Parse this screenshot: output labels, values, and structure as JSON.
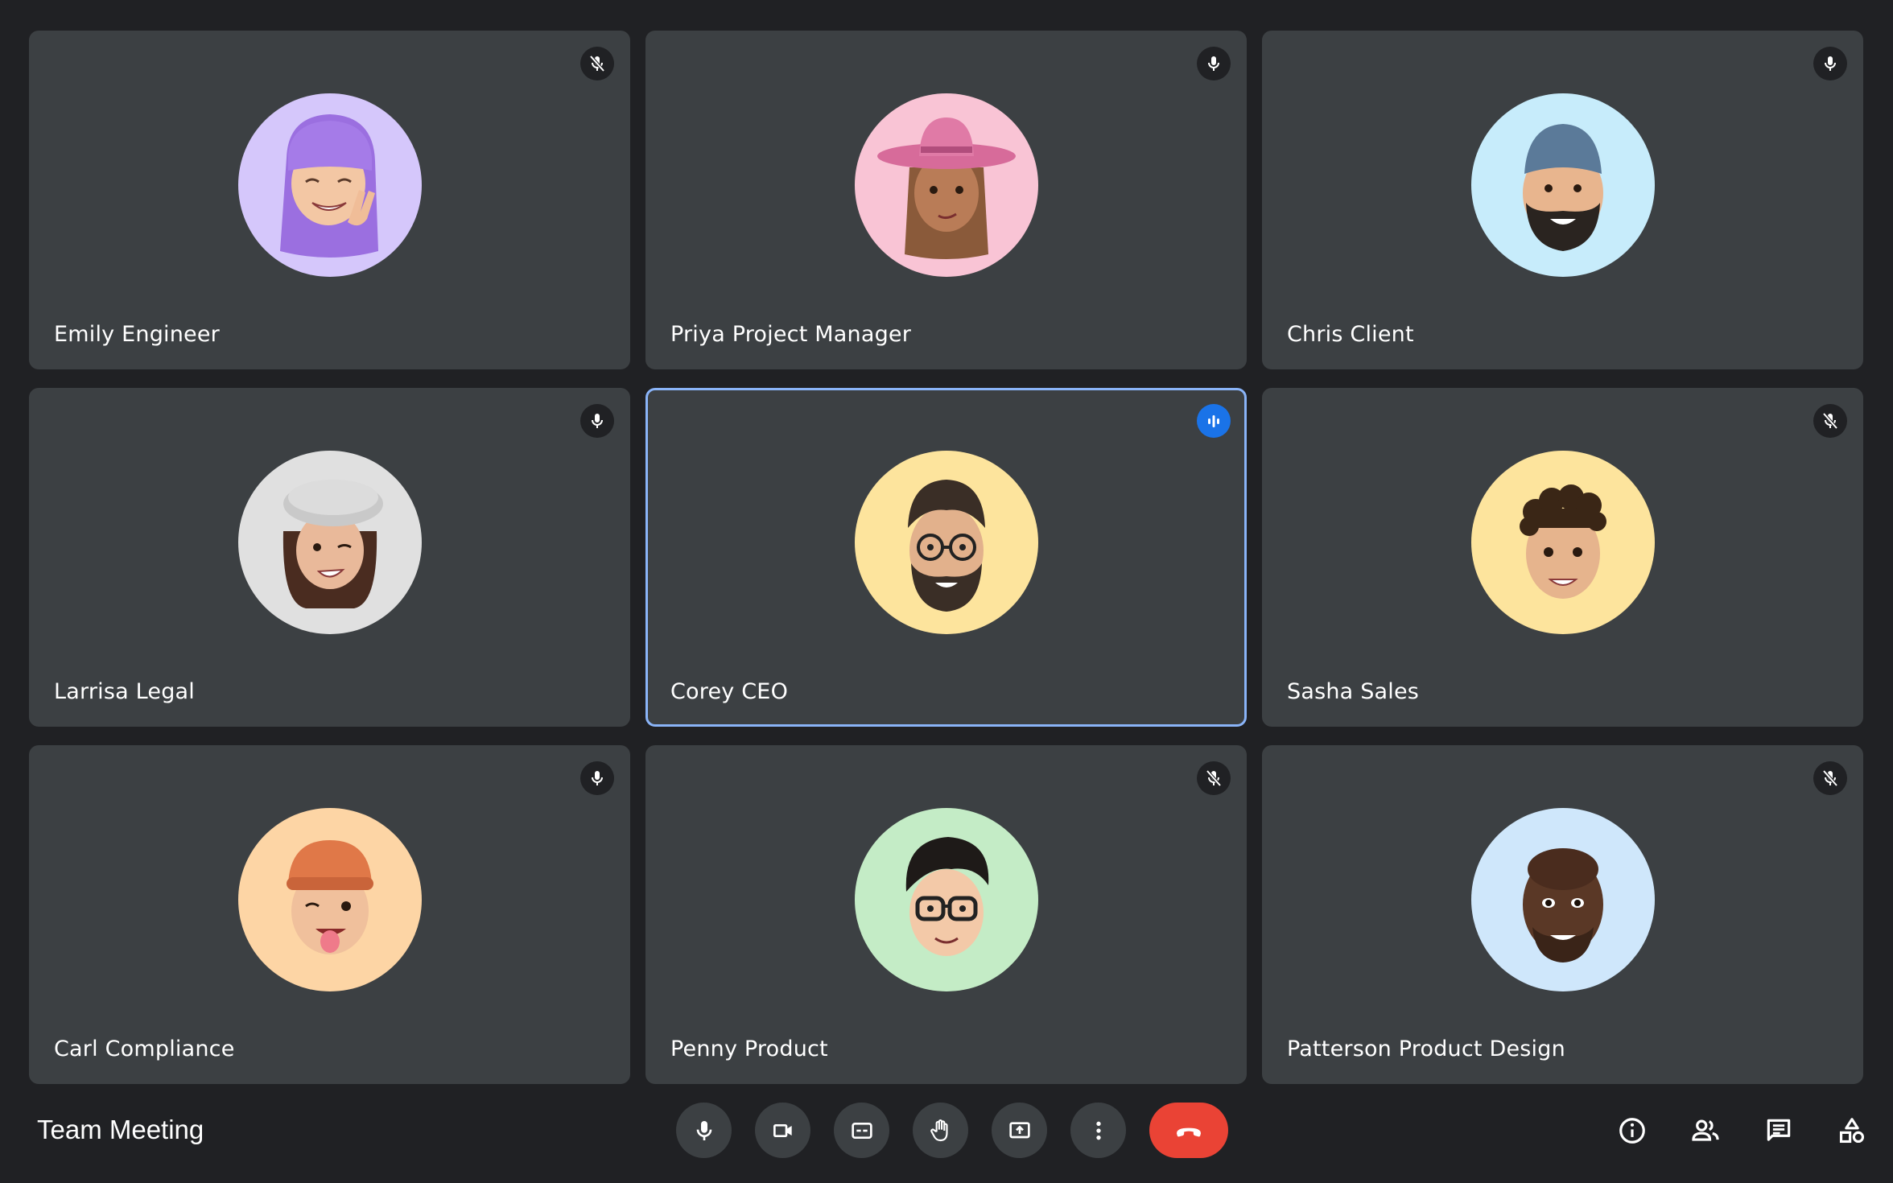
{
  "meeting": {
    "title": "Team Meeting"
  },
  "participants": [
    {
      "name": "Emily Engineer",
      "mic": "muted",
      "avatar_bg": "#d5c7fb",
      "icon": "mic-off-icon"
    },
    {
      "name": "Priya Project Manager",
      "mic": "on",
      "avatar_bg": "#f9c4d5",
      "icon": "mic-icon"
    },
    {
      "name": "Chris Client",
      "mic": "on",
      "avatar_bg": "#c7ecfb",
      "icon": "mic-icon"
    },
    {
      "name": "Larrisa Legal",
      "mic": "on",
      "avatar_bg": "#e0e0e0",
      "icon": "mic-icon"
    },
    {
      "name": "Corey CEO",
      "mic": "speaking",
      "avatar_bg": "#fde49d",
      "icon": "audio-level-icon"
    },
    {
      "name": "Sasha Sales",
      "mic": "muted",
      "avatar_bg": "#fde49d",
      "icon": "mic-off-icon"
    },
    {
      "name": "Carl Compliance",
      "mic": "on",
      "avatar_bg": "#fdd5a5",
      "icon": "mic-icon"
    },
    {
      "name": "Penny Product",
      "mic": "muted",
      "avatar_bg": "#c4ecc6",
      "icon": "mic-off-icon"
    },
    {
      "name": "Patterson Product Design",
      "mic": "muted",
      "avatar_bg": "#cfe7fb",
      "icon": "mic-off-icon"
    }
  ],
  "controls": [
    {
      "icon": "microphone-icon"
    },
    {
      "icon": "camera-icon"
    },
    {
      "icon": "captions-icon"
    },
    {
      "icon": "raise-hand-icon"
    },
    {
      "icon": "present-screen-icon"
    },
    {
      "icon": "more-options-icon"
    },
    {
      "icon": "end-call-icon"
    }
  ],
  "right_controls": [
    {
      "icon": "meeting-info-icon"
    },
    {
      "icon": "people-icon"
    },
    {
      "icon": "chat-icon"
    },
    {
      "icon": "activities-icon"
    }
  ],
  "colors": {
    "background": "#202124",
    "tile": "#3c4043",
    "speaking_border": "#8ab4f8",
    "speaking_badge": "#1a73e8",
    "end_call": "#ea4335"
  }
}
